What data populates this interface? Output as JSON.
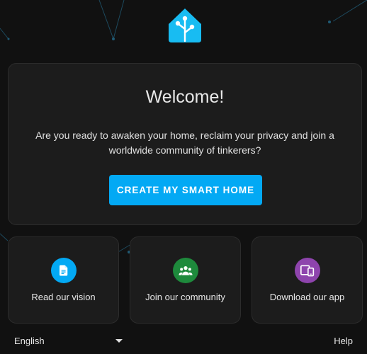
{
  "welcome": {
    "title": "Welcome!",
    "description": "Are you ready to awaken your home, reclaim your privacy and join a worldwide community of tinkerers?",
    "cta_label": "CREATE MY SMART HOME"
  },
  "features": [
    {
      "label": "Read our vision",
      "icon": "document-icon",
      "color": "#03a9f4"
    },
    {
      "label": "Join our community",
      "icon": "community-icon",
      "color": "#1e8a3c"
    },
    {
      "label": "Download our app",
      "icon": "devices-icon",
      "color": "#8e44ad"
    }
  ],
  "footer": {
    "language": "English",
    "help": "Help"
  },
  "colors": {
    "background": "#111111",
    "card": "#1c1c1c",
    "accent": "#03a9f4"
  }
}
